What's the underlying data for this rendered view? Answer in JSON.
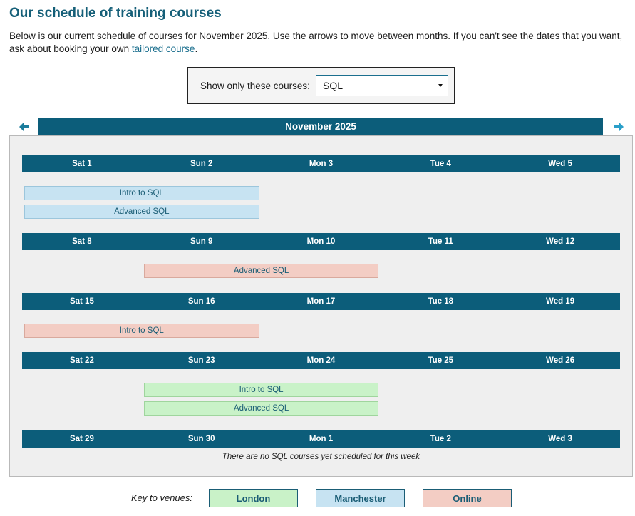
{
  "header": {
    "title": "Our schedule of training courses",
    "intro_text": "Below is our current schedule of courses for November 2025. Use the arrows to move between months. If you can't see the dates that you want, ask about booking your own ",
    "intro_link": "tailored course",
    "intro_end": "."
  },
  "filter": {
    "label": "Show only these courses:",
    "selected": "SQL"
  },
  "calendar": {
    "month_label": "November 2025",
    "weeks": [
      {
        "days": [
          "Sat 1",
          "Sun 2",
          "Mon 3",
          "Tue 4",
          "Wed 5"
        ],
        "courses": [
          {
            "name": "Intro to SQL",
            "venue": "Manchester",
            "start_day": 0,
            "span_days": 2
          },
          {
            "name": "Advanced SQL",
            "venue": "Manchester",
            "start_day": 0,
            "span_days": 2
          }
        ]
      },
      {
        "days": [
          "Sat 8",
          "Sun 9",
          "Mon 10",
          "Tue 11",
          "Wed 12"
        ],
        "courses": [
          {
            "name": "Advanced SQL",
            "venue": "Online",
            "start_day": 1,
            "span_days": 2
          }
        ]
      },
      {
        "days": [
          "Sat 15",
          "Sun 16",
          "Mon 17",
          "Tue 18",
          "Wed 19"
        ],
        "courses": [
          {
            "name": "Intro to SQL",
            "venue": "Online",
            "start_day": 0,
            "span_days": 2
          }
        ]
      },
      {
        "days": [
          "Sat 22",
          "Sun 23",
          "Mon 24",
          "Tue 25",
          "Wed 26"
        ],
        "courses": [
          {
            "name": "Intro to SQL",
            "venue": "London",
            "start_day": 1,
            "span_days": 2
          },
          {
            "name": "Advanced SQL",
            "venue": "London",
            "start_day": 1,
            "span_days": 2
          }
        ]
      },
      {
        "days": [
          "Sat 29",
          "Sun 30",
          "Mon 1",
          "Tue 2",
          "Wed 3"
        ],
        "courses": [],
        "empty_message": "There are no SQL courses yet scheduled for this week"
      }
    ]
  },
  "key": {
    "label": "Key to venues:",
    "venues": [
      {
        "name": "London",
        "color": "#c9f2c8"
      },
      {
        "name": "Manchester",
        "color": "#c7e3f2"
      },
      {
        "name": "Online",
        "color": "#f3cdc4"
      }
    ]
  },
  "icons": {
    "prev": "arrow-left-icon",
    "next": "arrow-right-icon"
  },
  "colors": {
    "accent": "#0c5d7a",
    "title": "#155f78"
  }
}
